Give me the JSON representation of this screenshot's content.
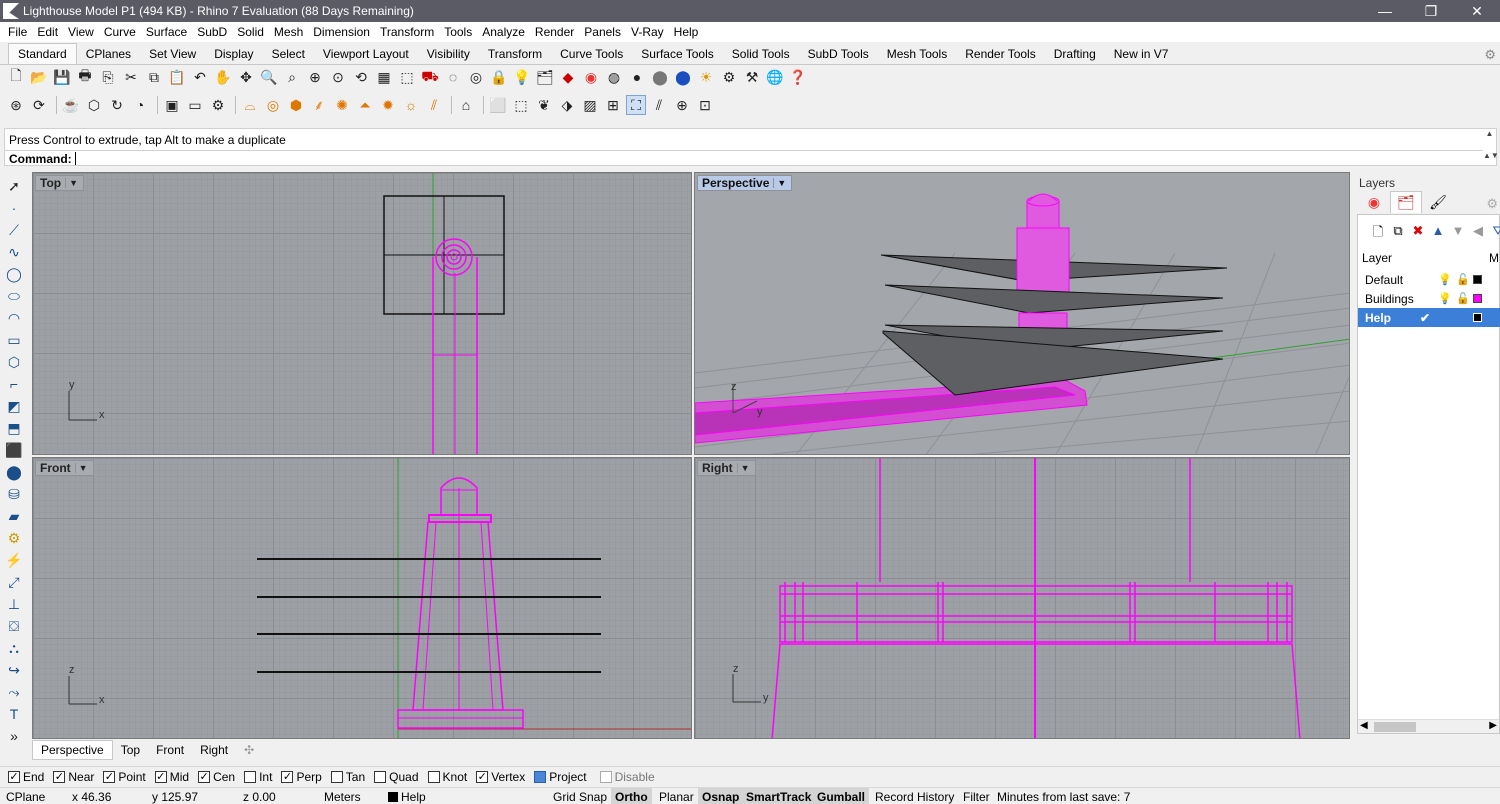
{
  "window": {
    "title": "Lighthouse Model P1 (494 KB) - Rhino 7 Evaluation (88 Days Remaining)",
    "controls": [
      "—",
      "❐",
      "✕"
    ]
  },
  "menu": [
    "File",
    "Edit",
    "View",
    "Curve",
    "Surface",
    "SubD",
    "Solid",
    "Mesh",
    "Dimension",
    "Transform",
    "Tools",
    "Analyze",
    "Render",
    "Panels",
    "V-Ray",
    "Help"
  ],
  "tabs": [
    "Standard",
    "CPlanes",
    "Set View",
    "Display",
    "Select",
    "Viewport Layout",
    "Visibility",
    "Transform",
    "Curve Tools",
    "Surface Tools",
    "Solid Tools",
    "SubD Tools",
    "Mesh Tools",
    "Render Tools",
    "Drafting",
    "New in V7"
  ],
  "active_tab": "Standard",
  "command": {
    "history": "Press Control to extrude, tap Alt to make a duplicate",
    "prompt": "Command:"
  },
  "viewports": {
    "top": "Top",
    "perspective": "Perspective",
    "front": "Front",
    "right": "Right"
  },
  "axes": {
    "x": "x",
    "y": "y",
    "z": "z"
  },
  "viewport_tabs": [
    "Perspective",
    "Top",
    "Front",
    "Right"
  ],
  "viewport_tab_add": "✣",
  "layers": {
    "panel_title": "Layers",
    "column_header": "Layer",
    "column_m": "M",
    "rows": [
      {
        "name": "Default",
        "color": "#000000",
        "current": false
      },
      {
        "name": "Buildings",
        "color": "#ff00ff",
        "current": false
      },
      {
        "name": "Help",
        "color": "#000000",
        "current": true
      }
    ]
  },
  "osnaps": [
    {
      "label": "End",
      "checked": true
    },
    {
      "label": "Near",
      "checked": true
    },
    {
      "label": "Point",
      "checked": true
    },
    {
      "label": "Mid",
      "checked": true
    },
    {
      "label": "Cen",
      "checked": true
    },
    {
      "label": "Int",
      "checked": false
    },
    {
      "label": "Perp",
      "checked": true
    },
    {
      "label": "Tan",
      "checked": false
    },
    {
      "label": "Quad",
      "checked": false
    },
    {
      "label": "Knot",
      "checked": false
    },
    {
      "label": "Vertex",
      "checked": true
    },
    {
      "label": "Project",
      "checked": true
    },
    {
      "label": "Disable",
      "checked": false
    }
  ],
  "status": {
    "cplane": "CPlane",
    "x": "x 46.36",
    "y": "y 125.97",
    "z": "z 0.00",
    "units": "Meters",
    "layer": "Help",
    "grid_snap": "Grid Snap",
    "ortho": "Ortho",
    "planar": "Planar",
    "osnap": "Osnap",
    "smarttrack": "SmartTrack",
    "gumball": "Gumball",
    "record_history": "Record History",
    "filter": "Filter",
    "save_info": "Minutes from last save: 7"
  },
  "colors": {
    "object_magenta": "#ff00ff",
    "viewport_bg": "#9da0a5",
    "selected_layer": "#3c7fd8",
    "x_axis": "#b03030",
    "y_axis": "#30a030"
  }
}
